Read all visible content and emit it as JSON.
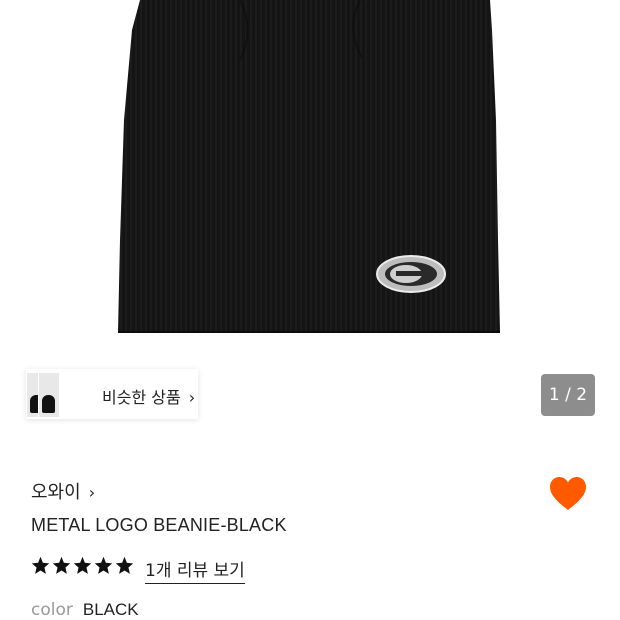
{
  "similar": {
    "label": "비슷한 상품",
    "chevron": "›"
  },
  "pager": {
    "current": "1",
    "separator": "/",
    "total": "2",
    "text": "1 / 2"
  },
  "product": {
    "brand": "오와이",
    "title": "METAL LOGO BEANIE-BLACK",
    "rating_stars": 5,
    "review_link": "1개 리뷰 보기",
    "color_label": "color",
    "color_value": "BLACK"
  },
  "icons": {
    "brand_chevron": "chevron-right-icon",
    "wishlist": "heart-icon",
    "star": "star-icon"
  },
  "colors": {
    "heart": "#ff5a00",
    "star": "#111111",
    "pager_bg": "#7a7a7a"
  }
}
